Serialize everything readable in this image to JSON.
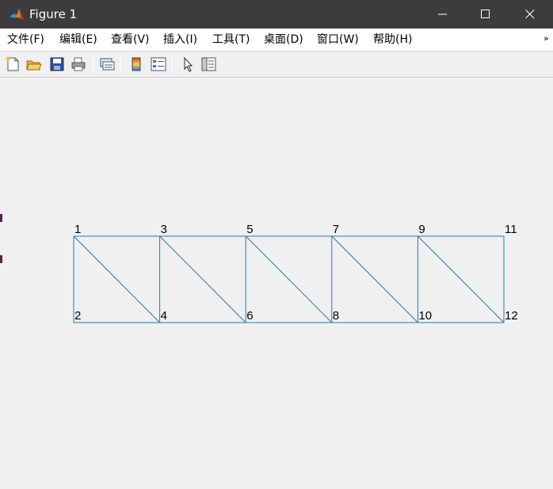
{
  "window": {
    "title": "Figure 1",
    "controls": [
      "minimize-icon",
      "maximize-icon",
      "close-icon"
    ]
  },
  "menu": {
    "items": [
      {
        "label": "文件(F)"
      },
      {
        "label": "编辑(E)"
      },
      {
        "label": "查看(V)"
      },
      {
        "label": "插入(I)"
      },
      {
        "label": "工具(T)"
      },
      {
        "label": "桌面(D)"
      },
      {
        "label": "窗口(W)"
      },
      {
        "label": "帮助(H)"
      }
    ],
    "overflow_icon": "chevron-double-right-icon"
  },
  "toolbar": {
    "tools": [
      "new-figure-icon",
      "open-file-icon",
      "save-icon",
      "print-icon",
      "link-plot-icon",
      "colorbar-icon",
      "legend-icon",
      "edit-plot-arrow-icon",
      "property-inspector-icon"
    ]
  },
  "plot": {
    "colors": {
      "edge": "#1f7ab8",
      "background": "#f0f0f0"
    },
    "nodes": [
      {
        "id": "1",
        "label": "1",
        "x": 0,
        "y": 1
      },
      {
        "id": "2",
        "label": "2",
        "x": 0,
        "y": 0
      },
      {
        "id": "3",
        "label": "3",
        "x": 1,
        "y": 1
      },
      {
        "id": "4",
        "label": "4",
        "x": 1,
        "y": 0
      },
      {
        "id": "5",
        "label": "5",
        "x": 2,
        "y": 1
      },
      {
        "id": "6",
        "label": "6",
        "x": 2,
        "y": 0
      },
      {
        "id": "7",
        "label": "7",
        "x": 3,
        "y": 1
      },
      {
        "id": "8",
        "label": "8",
        "x": 3,
        "y": 0
      },
      {
        "id": "9",
        "label": "9",
        "x": 4,
        "y": 1
      },
      {
        "id": "10",
        "label": "10",
        "x": 4,
        "y": 0
      },
      {
        "id": "11",
        "label": "11",
        "x": 5,
        "y": 1
      },
      {
        "id": "12",
        "label": "12",
        "x": 5,
        "y": 0
      }
    ],
    "edges": [
      [
        "1",
        "3"
      ],
      [
        "3",
        "5"
      ],
      [
        "5",
        "7"
      ],
      [
        "7",
        "9"
      ],
      [
        "9",
        "11"
      ],
      [
        "2",
        "4"
      ],
      [
        "4",
        "6"
      ],
      [
        "6",
        "8"
      ],
      [
        "8",
        "10"
      ],
      [
        "10",
        "12"
      ],
      [
        "1",
        "2"
      ],
      [
        "3",
        "4"
      ],
      [
        "5",
        "6"
      ],
      [
        "7",
        "8"
      ],
      [
        "9",
        "10"
      ],
      [
        "11",
        "12"
      ],
      [
        "1",
        "4"
      ],
      [
        "3",
        "6"
      ],
      [
        "5",
        "8"
      ],
      [
        "7",
        "10"
      ],
      [
        "9",
        "12"
      ]
    ]
  }
}
